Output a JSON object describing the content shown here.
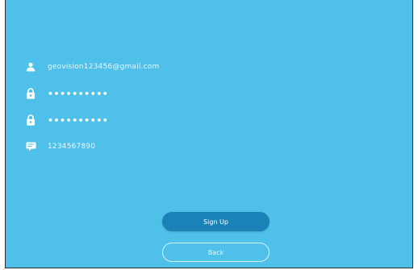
{
  "fields": {
    "email": {
      "value": "geovision123456@gmail.com",
      "icon": "user-icon"
    },
    "password": {
      "value": "••••••••••",
      "icon": "lock-icon"
    },
    "confirm_password": {
      "value": "••••••••••",
      "icon": "lock-icon"
    },
    "verification": {
      "value": "1234567890",
      "icon": "message-icon"
    }
  },
  "buttons": {
    "sign_up": "Sign Up",
    "back": "Back"
  },
  "colors": {
    "background": "#4fc0ea",
    "primary_button": "#1b82b8",
    "text": "#eaf7fd"
  }
}
